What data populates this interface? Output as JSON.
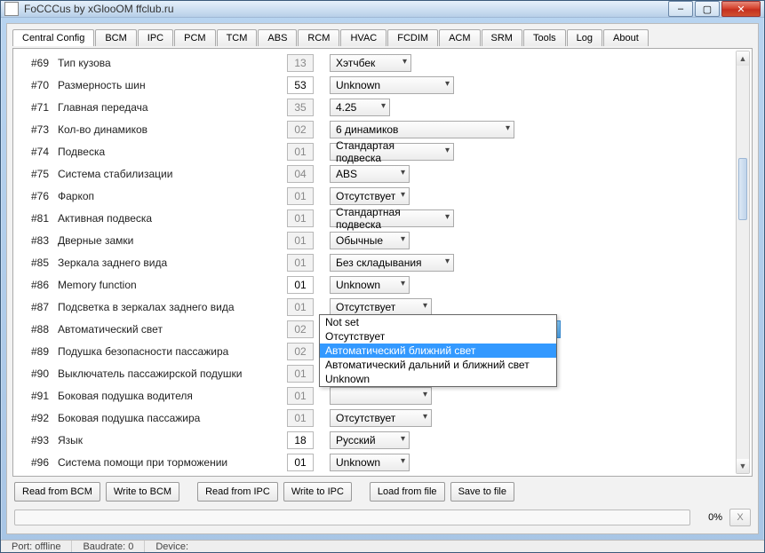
{
  "window": {
    "title": "FoCCCus by xGlooOM ffclub.ru"
  },
  "tabs": [
    "Central Config",
    "BCM",
    "IPC",
    "PCM",
    "TCM",
    "ABS",
    "RCM",
    "HVAC",
    "FCDIM",
    "ACM",
    "SRM",
    "Tools",
    "Log",
    "About"
  ],
  "rows": [
    {
      "idx": "#69",
      "label": "Тип кузова",
      "val": "13",
      "valDisabled": true,
      "sel": "Хэтчбек",
      "w": "w1"
    },
    {
      "idx": "#70",
      "label": "Размерность шин",
      "val": "53",
      "sel": "Unknown",
      "w": "w2"
    },
    {
      "idx": "#71",
      "label": "Главная передача",
      "val": "35",
      "valDisabled": true,
      "sel": "4.25",
      "w": "w3"
    },
    {
      "idx": "#73",
      "label": "Кол-во динамиков",
      "val": "02",
      "valDisabled": true,
      "sel": "6 динамиков",
      "w": "w4"
    },
    {
      "idx": "#74",
      "label": "Подвеска",
      "val": "01",
      "valDisabled": true,
      "sel": "Стандартая подвеска",
      "w": "w2"
    },
    {
      "idx": "#75",
      "label": "Система стабилизации",
      "val": "04",
      "valDisabled": true,
      "sel": "ABS",
      "w": "w7"
    },
    {
      "idx": "#76",
      "label": "Фаркоп",
      "val": "01",
      "valDisabled": true,
      "sel": "Отсутствует",
      "w": "w7"
    },
    {
      "idx": "#81",
      "label": "Активная подвеска",
      "val": "01",
      "valDisabled": true,
      "sel": "Стандартная подвеска",
      "w": "w2"
    },
    {
      "idx": "#83",
      "label": "Дверные замки",
      "val": "01",
      "valDisabled": true,
      "sel": "Обычные",
      "w": "w7"
    },
    {
      "idx": "#85",
      "label": "Зеркала заднего вида",
      "val": "01",
      "valDisabled": true,
      "sel": "Без складывания",
      "w": "w2"
    },
    {
      "idx": "#86",
      "label": "Memory function",
      "val": "01",
      "sel": "Unknown",
      "w": "w7"
    },
    {
      "idx": "#87",
      "label": "Подсветка в зеркалах заднего вида",
      "val": "01",
      "valDisabled": true,
      "sel": "Отсутствует",
      "w": "w5"
    },
    {
      "idx": "#88",
      "label": "Автоматический свет",
      "val": "02",
      "valDisabled": true,
      "sel": "Автоматический ближний свет",
      "w": "w6",
      "open": true
    },
    {
      "idx": "#89",
      "label": "Подушка безопасности пассажира",
      "val": "02",
      "valDisabled": true,
      "sel": "",
      "w": "w5"
    },
    {
      "idx": "#90",
      "label": "Выключатель пассажирской подушки",
      "val": "01",
      "valDisabled": true,
      "sel": "",
      "w": "w5"
    },
    {
      "idx": "#91",
      "label": "Боковая подушка водителя",
      "val": "01",
      "valDisabled": true,
      "sel": "",
      "w": "w5"
    },
    {
      "idx": "#92",
      "label": "Боковая подушка пассажира",
      "val": "01",
      "valDisabled": true,
      "sel": "Отсутствует",
      "w": "w5"
    },
    {
      "idx": "#93",
      "label": "Язык",
      "val": "18",
      "sel": "Русский",
      "w": "w7"
    },
    {
      "idx": "#96",
      "label": "Система помощи при торможении",
      "val": "01",
      "sel": "Unknown",
      "w": "w7"
    }
  ],
  "dropdown": {
    "items": [
      "Not set",
      "Отсутствует",
      "Автоматический ближний свет",
      "Автоматический дальний и ближний свет",
      "Unknown"
    ],
    "selectedIndex": 2
  },
  "buttons": {
    "read_bcm": "Read from BCM",
    "write_bcm": "Write to BCM",
    "read_ipc": "Read from IPC",
    "write_ipc": "Write to IPC",
    "load": "Load from file",
    "save": "Save to file"
  },
  "progress": {
    "pct": "0%",
    "x": "X"
  },
  "status": {
    "port": "Port: offline",
    "baud": "Baudrate: 0",
    "dev": "Device:"
  }
}
